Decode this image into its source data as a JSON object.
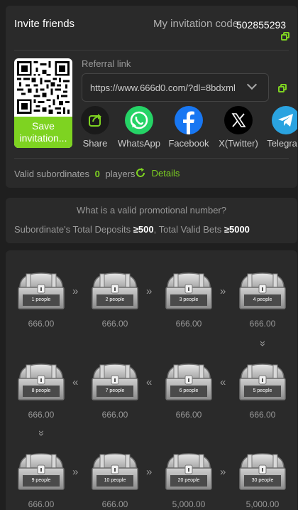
{
  "invite": {
    "title": "Invite friends",
    "code_label": "My invitation code",
    "code_value": "502855293",
    "save_label_line1": "Save",
    "save_label_line2": "invitation...",
    "referral_label": "Referral link",
    "referral_link": "https://www.666d0.com/?dl=8bdxml",
    "share": [
      {
        "label": "Share",
        "icon": "share-icon"
      },
      {
        "label": "WhatsApp",
        "icon": "whatsapp-icon"
      },
      {
        "label": "Facebook",
        "icon": "facebook-icon"
      },
      {
        "label": "X(Twitter)",
        "icon": "x-twitter-icon"
      },
      {
        "label": "Telegram",
        "icon": "telegram-icon"
      }
    ],
    "valid_label": "Valid subordinates",
    "valid_count": "0",
    "players_label": "players",
    "details_label": "Details"
  },
  "rule": {
    "question": "What is a valid promotional number?",
    "deposits_label": "Subordinate's Total Deposits",
    "deposits_value": "≥500",
    "separator": ",",
    "bets_label": "Total Valid Bets",
    "bets_value": "≥5000"
  },
  "rewards": [
    {
      "people": "1 people",
      "amount": "666.00"
    },
    {
      "people": "2 people",
      "amount": "666.00"
    },
    {
      "people": "3 people",
      "amount": "666.00"
    },
    {
      "people": "4 people",
      "amount": "666.00"
    },
    {
      "people": "5 people",
      "amount": "666.00"
    },
    {
      "people": "6 people",
      "amount": "666.00"
    },
    {
      "people": "7 people",
      "amount": "666.00"
    },
    {
      "people": "8 people",
      "amount": "666.00"
    },
    {
      "people": "9 people",
      "amount": "666.00"
    },
    {
      "people": "10 people",
      "amount": "666.00"
    },
    {
      "people": "20 people",
      "amount": "5,000.00"
    },
    {
      "people": "30 people",
      "amount": "5,000.00"
    }
  ],
  "colors": {
    "accent": "#7ed321",
    "whatsapp": "#25d366",
    "facebook": "#1877f2",
    "telegram": "#2aa3e0"
  }
}
